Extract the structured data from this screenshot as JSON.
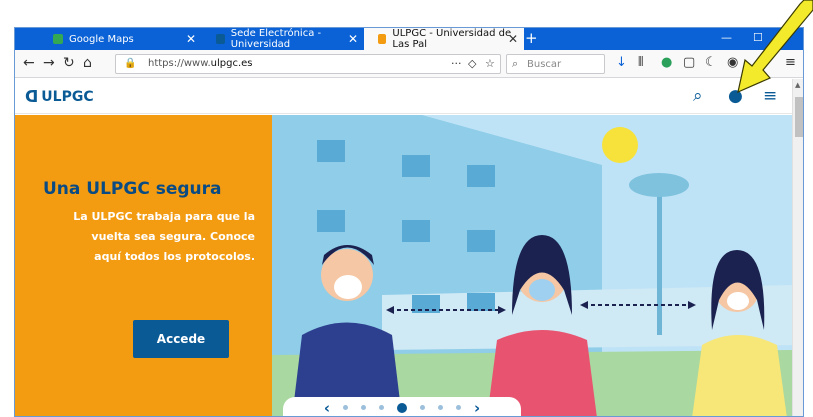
{
  "browser": {
    "tabs": [
      {
        "title": "Google Maps",
        "favicon": "google-maps-favicon",
        "active": false
      },
      {
        "title": "Sede Electrónica - Universidad",
        "favicon": "ulpgc-favicon",
        "active": false
      },
      {
        "title": "ULPGC - Universidad de Las Pal",
        "favicon": "ulpgc-favicon",
        "active": true
      }
    ],
    "url_prefix": "https://www.",
    "url_domain": "ulpgc.es",
    "search_placeholder": "Buscar"
  },
  "site": {
    "logo_text": "ULPGC",
    "hero": {
      "title": "Una ULPGC segura",
      "body_line1": "La ULPGC trabaja para que la",
      "body_line2": "vuelta sea segura. Conoce",
      "body_line3": "aquí todos los protocolos.",
      "cta_label": "Accede"
    },
    "carousel": {
      "dots": 7,
      "active_index": 3
    }
  },
  "colors": {
    "brand": "#0a5a96",
    "hero_orange": "#f39c12",
    "annotation_arrow": "#f3ea2c"
  }
}
